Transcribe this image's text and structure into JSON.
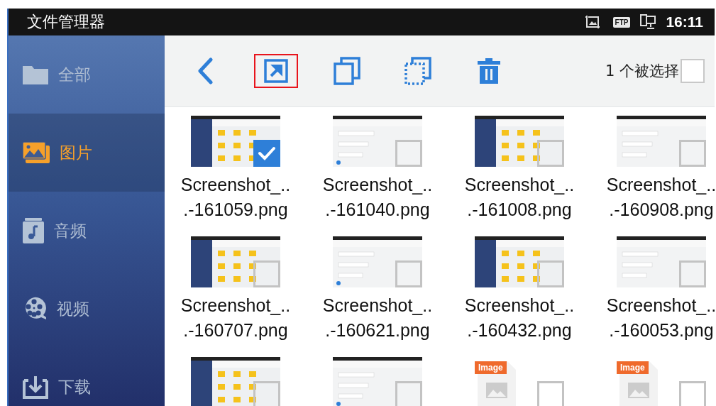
{
  "status_bar": {
    "title": "文件管理器",
    "ftp_badge": "FTP",
    "time": "16:11"
  },
  "sidebar": {
    "items": [
      {
        "kind": "folder",
        "label": "全部",
        "selected": false
      },
      {
        "kind": "pictures",
        "label": "图片",
        "selected": true
      },
      {
        "kind": "audio",
        "label": "音频",
        "selected": false
      },
      {
        "kind": "video",
        "label": "视频",
        "selected": false
      },
      {
        "kind": "download",
        "label": "下载",
        "selected": false
      }
    ]
  },
  "toolbar": {
    "actions": [
      {
        "kind": "back",
        "highlighted": false
      },
      {
        "kind": "share",
        "highlighted": true
      },
      {
        "kind": "copy",
        "highlighted": false
      },
      {
        "kind": "select_all",
        "highlighted": false
      },
      {
        "kind": "delete",
        "highlighted": false
      }
    ],
    "selection_count": "1 个被选择",
    "select_all_checked": false
  },
  "files": [
    {
      "kind": "screenshot",
      "name_lines": [
        "Screenshot_..",
        ".-161059.png"
      ],
      "checked": true
    },
    {
      "kind": "screenshot",
      "name_lines": [
        "Screenshot_..",
        ".-161040.png"
      ],
      "checked": false
    },
    {
      "kind": "screenshot",
      "name_lines": [
        "Screenshot_..",
        ".-161008.png"
      ],
      "checked": false
    },
    {
      "kind": "screenshot",
      "name_lines": [
        "Screenshot_..",
        ".-160908.png"
      ],
      "checked": false
    },
    {
      "kind": "screenshot",
      "name_lines": [
        "Screenshot_..",
        ".-160707.png"
      ],
      "checked": false
    },
    {
      "kind": "screenshot",
      "name_lines": [
        "Screenshot_..",
        ".-160621.png"
      ],
      "checked": false
    },
    {
      "kind": "screenshot",
      "name_lines": [
        "Screenshot_..",
        ".-160432.png"
      ],
      "checked": false
    },
    {
      "kind": "screenshot",
      "name_lines": [
        "Screenshot_..",
        ".-160053.png"
      ],
      "checked": false
    },
    {
      "kind": "screenshot",
      "checked": false
    },
    {
      "kind": "screenshot",
      "checked": false
    },
    {
      "kind": "image_file",
      "icon_label": "Image",
      "checked": false
    },
    {
      "kind": "image_file",
      "icon_label": "Image",
      "checked": false
    }
  ]
}
